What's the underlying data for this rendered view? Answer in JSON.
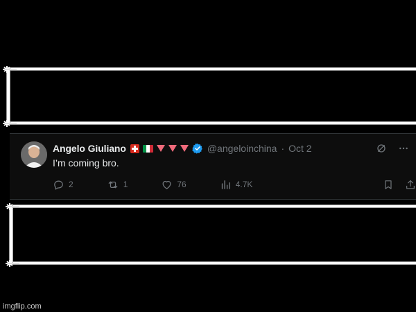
{
  "tweet": {
    "author_name": "Angelo Giuliano",
    "handle": "@angeloinchina",
    "separator": "·",
    "date": "Oct 2",
    "text": "I’m coming bro.",
    "counts": {
      "replies": "2",
      "retweets": "1",
      "likes": "76",
      "views": "4.7K"
    },
    "badges": [
      "swiss-flag",
      "italy-flag",
      "red-triangle",
      "red-triangle",
      "red-triangle",
      "verified-badge"
    ]
  },
  "watermark": {
    "text": "imgflip.com"
  },
  "colors": {
    "background": "#000000",
    "card": "#0d0d0d",
    "text_primary": "#e7e9ea",
    "text_secondary": "#71767b",
    "verified_blue": "#1d9bf0",
    "triangle_red": "#f06a7b",
    "frame_white": "#ffffff"
  },
  "icons": {
    "reply": "reply-icon",
    "retweet": "retweet-icon",
    "like": "heart-icon",
    "views": "views-icon",
    "bookmark": "bookmark-icon",
    "share": "share-icon",
    "grok": "grok-icon",
    "more": "more-icon"
  }
}
